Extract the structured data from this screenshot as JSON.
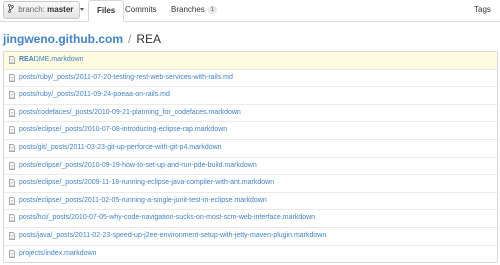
{
  "branch": {
    "label": "branch:",
    "value": "master"
  },
  "tabs": [
    {
      "label": "Files",
      "active": true
    },
    {
      "label": "Commits"
    },
    {
      "label": "Branches",
      "count": "1"
    },
    {
      "label": "Tags"
    }
  ],
  "breadcrumb": {
    "repo": "jingweno.github.com",
    "separator": "/",
    "query": "REA"
  },
  "files": [
    {
      "match": "REA",
      "rest": "DME.markdown"
    },
    {
      "path": "posts/ruby/_posts/2011-07-20-testing-rest-web-services-with-rails.md"
    },
    {
      "path": "posts/ruby/_posts/2011-09-24-poeaa-on-rails.md"
    },
    {
      "path": "posts/codefaces/_posts/2010-09-21-planning_for_codefaces.markdown"
    },
    {
      "path": "posts/eclipse/_posts/2010-07-08-introducing-eclipse-rap.markdown"
    },
    {
      "path": "posts/git/_posts/2011-03-23-git-up-perforce-with-git-p4.markdown"
    },
    {
      "path": "posts/eclipse/_posts/2010-09-19-how-to-set-up-and-run-pde-build.markdown"
    },
    {
      "path": "posts/eclipse/_posts/2009-11-18-running-eclipse-java-compiler-with-ant.markdown"
    },
    {
      "path": "posts/eclipse/_posts/2011-02-05-running-a-single-junit-test-in-eclipse.markdown"
    },
    {
      "path": "posts/hci/_posts/2010-07-05-why-code-navigation-sucks-on-most-scm-web-interface.markdown"
    },
    {
      "path": "posts/java/_posts/2011-02-23-speed-up-j2ee-environment-setup-with-jetty-maven-plugin.markdown"
    },
    {
      "path": "projects/index.markdown"
    }
  ],
  "icons": {
    "branch": "branch-icon",
    "file": "file-icon",
    "dropdown": "chevron-down-icon"
  },
  "colors": {
    "link": "#4183c4",
    "selected_row": "#fefbe1",
    "border": "#d8d8d8"
  }
}
